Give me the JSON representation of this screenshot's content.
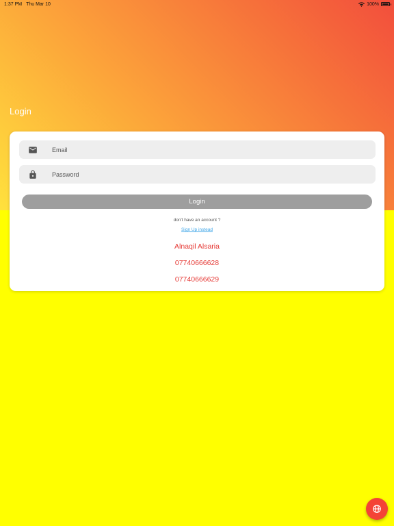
{
  "status_bar": {
    "time": "1:37 PM",
    "date": "Thu Mar 10",
    "battery": "100%",
    "wifi_icon": "wifi-icon",
    "battery_icon": "battery-icon"
  },
  "page": {
    "title": "Login"
  },
  "form": {
    "email": {
      "placeholder": "Email",
      "value": "",
      "icon": "mail-icon"
    },
    "password": {
      "placeholder": "Password",
      "value": "",
      "icon": "lock-icon"
    },
    "login_label": "Login",
    "no_account_text": "don't have an account ?",
    "signup_label": "Sign Up instead"
  },
  "contact": {
    "name": "Alnaqil Alsaria",
    "phones": [
      "07740666628",
      "07740666629"
    ]
  },
  "fab": {
    "icon": "globe-icon"
  },
  "colors": {
    "background": "#ffff00",
    "gradient_start": "#f24e3c",
    "gradient_end": "#ffe13d",
    "card": "#ffffff",
    "field": "#eeeeee",
    "button_disabled": "#9e9e9e",
    "link": "#3fa6e8",
    "accent": "#e53935",
    "fab": "#f44336"
  }
}
